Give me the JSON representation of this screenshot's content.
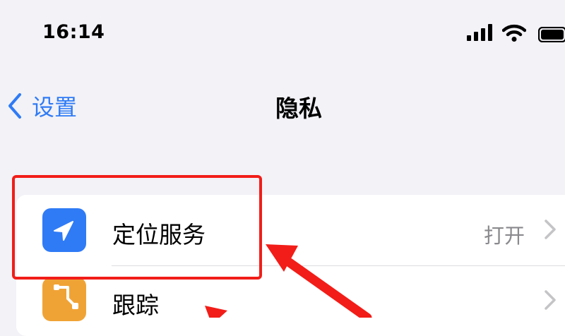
{
  "status_bar": {
    "time": "16:14",
    "icons": [
      "cellular-signal-icon",
      "wifi-icon",
      "battery-icon"
    ]
  },
  "nav": {
    "back_label": "设置",
    "title": "隐私"
  },
  "list": [
    {
      "label": "定位服务",
      "value": "打开",
      "icon": "location-arrow-icon",
      "icon_color": "#2F7BF6"
    },
    {
      "label": "跟踪",
      "value": "",
      "icon": "tracking-icon",
      "icon_color": "#F0A335"
    }
  ],
  "colors": {
    "accent": "#2F7BF6",
    "annotation": "#F21D18",
    "background": "#F2F2F7"
  }
}
